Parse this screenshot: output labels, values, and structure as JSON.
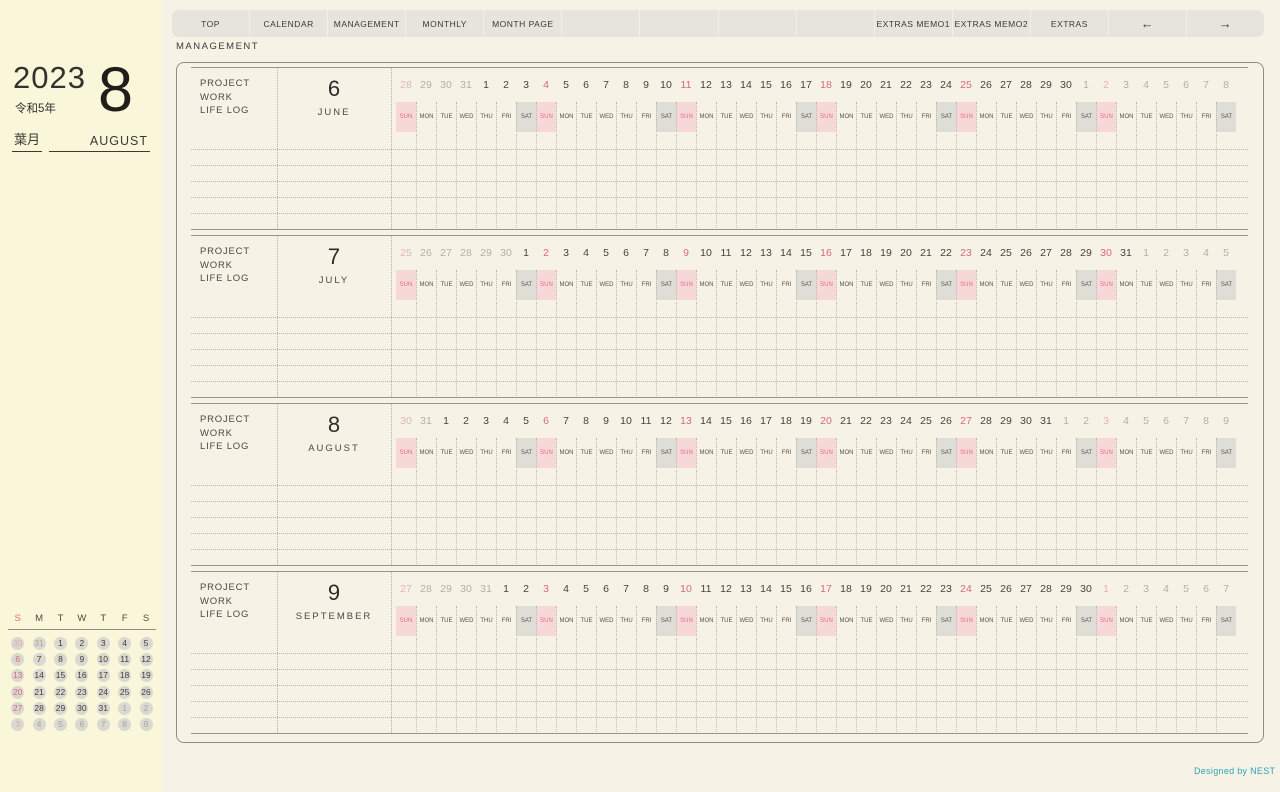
{
  "page_label": "MANAGEMENT",
  "nav": {
    "items": [
      {
        "name": "tab-top",
        "label": "TOP"
      },
      {
        "name": "tab-calendar",
        "label": "CALENDAR"
      },
      {
        "name": "tab-management",
        "label": "MANAGEMENT"
      },
      {
        "name": "tab-monthly",
        "label": "MONTHLY"
      },
      {
        "name": "tab-month-page",
        "label": "MONTH PAGE"
      },
      {
        "name": "tab-empty-1",
        "label": ""
      },
      {
        "name": "tab-empty-2",
        "label": ""
      },
      {
        "name": "tab-empty-3",
        "label": ""
      },
      {
        "name": "tab-empty-4",
        "label": ""
      },
      {
        "name": "tab-extras-memo1",
        "label": "EXTRAS MEMO1"
      },
      {
        "name": "tab-extras-memo2",
        "label": "EXTRAS MEMO2"
      },
      {
        "name": "tab-extras",
        "label": "EXTRAS"
      },
      {
        "name": "nav-prev",
        "label": "←",
        "arrow": true
      },
      {
        "name": "nav-next",
        "label": "→",
        "arrow": true
      }
    ]
  },
  "sidebar": {
    "year": "2023",
    "era": "令和5年",
    "month_number": "8",
    "month_kanji": "葉月",
    "month_name": "AUGUST",
    "mini_calendar": {
      "header": [
        "S",
        "M",
        "T",
        "W",
        "T",
        "F",
        "S"
      ],
      "lead": 2,
      "trail": 9,
      "days": [
        30,
        31,
        1,
        2,
        3,
        4,
        5,
        6,
        7,
        8,
        9,
        10,
        11,
        12,
        13,
        14,
        15,
        16,
        17,
        18,
        19,
        20,
        21,
        22,
        23,
        24,
        25,
        26,
        27,
        28,
        29,
        30,
        31,
        1,
        2,
        3,
        4,
        5,
        6,
        7,
        8,
        9
      ]
    }
  },
  "panel": {
    "row_labels": [
      "PROJECT",
      "WORK",
      "LIFE LOG"
    ],
    "weekdays": [
      "SUN",
      "MON",
      "TUE",
      "WED",
      "THU",
      "FRI",
      "SAT"
    ],
    "months": [
      {
        "number": "6",
        "name": "JUNE",
        "lead": 4,
        "trail": 8,
        "days": [
          28,
          29,
          30,
          31,
          1,
          2,
          3,
          4,
          5,
          6,
          7,
          8,
          9,
          10,
          11,
          12,
          13,
          14,
          15,
          16,
          17,
          18,
          19,
          20,
          21,
          22,
          23,
          24,
          25,
          26,
          27,
          28,
          29,
          30,
          1,
          2,
          3,
          4,
          5,
          6,
          7,
          8
        ]
      },
      {
        "number": "7",
        "name": "JULY",
        "lead": 6,
        "trail": 5,
        "days": [
          25,
          26,
          27,
          28,
          29,
          30,
          1,
          2,
          3,
          4,
          5,
          6,
          7,
          8,
          9,
          10,
          11,
          12,
          13,
          14,
          15,
          16,
          17,
          18,
          19,
          20,
          21,
          22,
          23,
          24,
          25,
          26,
          27,
          28,
          29,
          30,
          31,
          1,
          2,
          3,
          4,
          5
        ]
      },
      {
        "number": "8",
        "name": "AUGUST",
        "lead": 2,
        "trail": 9,
        "days": [
          30,
          31,
          1,
          2,
          3,
          4,
          5,
          6,
          7,
          8,
          9,
          10,
          11,
          12,
          13,
          14,
          15,
          16,
          17,
          18,
          19,
          20,
          21,
          22,
          23,
          24,
          25,
          26,
          27,
          28,
          29,
          30,
          31,
          1,
          2,
          3,
          4,
          5,
          6,
          7,
          8,
          9
        ]
      },
      {
        "number": "9",
        "name": "SEPTEMBER",
        "lead": 5,
        "trail": 7,
        "days": [
          27,
          28,
          29,
          30,
          31,
          1,
          2,
          3,
          4,
          5,
          6,
          7,
          8,
          9,
          10,
          11,
          12,
          13,
          14,
          15,
          16,
          17,
          18,
          19,
          20,
          21,
          22,
          23,
          24,
          25,
          26,
          27,
          28,
          29,
          30,
          1,
          2,
          3,
          4,
          5,
          6,
          7
        ]
      }
    ]
  },
  "footer": {
    "credit": "Designed by NEST"
  },
  "colors": {
    "sidebar_bg": "#faf6da",
    "main_bg": "#f6f3e6",
    "nav_bg": "#e6e4dc",
    "sunday_text": "#d9687e",
    "sunday_bg": "#f7d8d9",
    "saturday_bg": "#dfded6",
    "faded_text": "#b2b0a6",
    "credit_text": "#2ea4b6"
  }
}
